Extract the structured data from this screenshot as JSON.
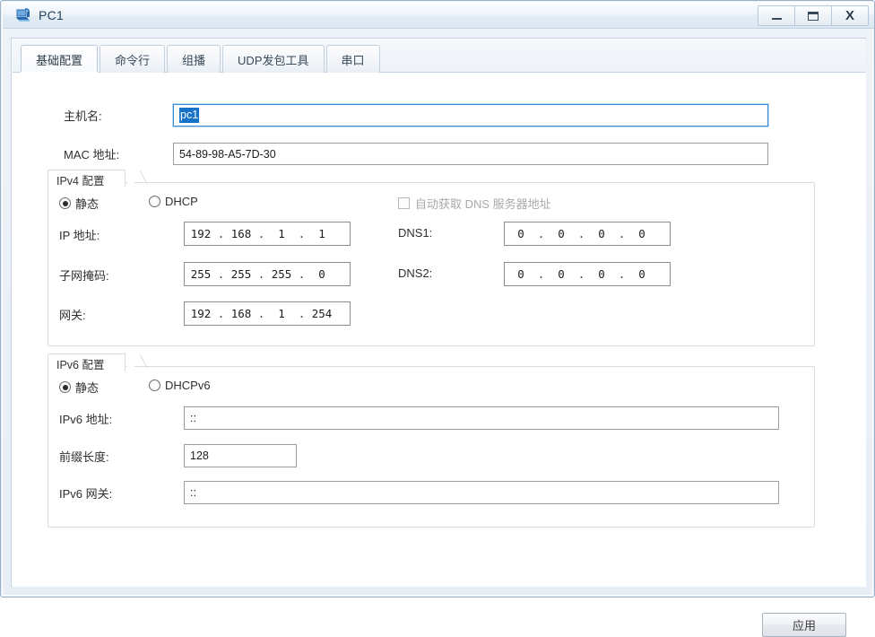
{
  "window": {
    "title": "PC1",
    "icon": "pc-device-icon",
    "controls": {
      "minimize": "minimize-icon",
      "maximize": "maximize-icon",
      "close": "X"
    }
  },
  "tabs": [
    {
      "label": "基础配置",
      "active": true
    },
    {
      "label": "命令行",
      "active": false
    },
    {
      "label": "组播",
      "active": false
    },
    {
      "label": "UDP发包工具",
      "active": false
    },
    {
      "label": "串口",
      "active": false
    }
  ],
  "basic": {
    "hostname_label": "主机名:",
    "hostname_value": "pc1",
    "hostname_selected": true,
    "mac_label": "MAC 地址:",
    "mac_value": "54-89-98-A5-7D-30"
  },
  "ipv4": {
    "group_label": "IPv4 配置",
    "static_label": "静态",
    "static_selected": true,
    "dhcp_label": "DHCP",
    "dhcp_selected": false,
    "dns_auto_label": "自动获取 DNS 服务器地址",
    "dns_auto_checked": false,
    "dns_auto_disabled": true,
    "ip_label": "IP 地址:",
    "ip_octets": [
      "192",
      "168",
      "1",
      "1"
    ],
    "mask_label": "子网掩码:",
    "mask_octets": [
      "255",
      "255",
      "255",
      "0"
    ],
    "gateway_label": "网关:",
    "gateway_octets": [
      "192",
      "168",
      "1",
      "254"
    ],
    "dns1_label": "DNS1:",
    "dns1_octets": [
      "0",
      "0",
      "0",
      "0"
    ],
    "dns2_label": "DNS2:",
    "dns2_octets": [
      "0",
      "0",
      "0",
      "0"
    ]
  },
  "ipv6": {
    "group_label": "IPv6 配置",
    "static_label": "静态",
    "static_selected": true,
    "dhcpv6_label": "DHCPv6",
    "dhcpv6_selected": false,
    "address_label": "IPv6 地址:",
    "address_value": "::",
    "prefix_label": "前缀长度:",
    "prefix_value": "128",
    "gateway_label": "IPv6 网关:",
    "gateway_value": "::"
  },
  "footer": {
    "apply_label": "应用"
  },
  "colors": {
    "accent": "#1673c8",
    "focus_border": "#3b8ad9",
    "title_text": "#20415e",
    "disabled_text": "#a9a9a9"
  }
}
